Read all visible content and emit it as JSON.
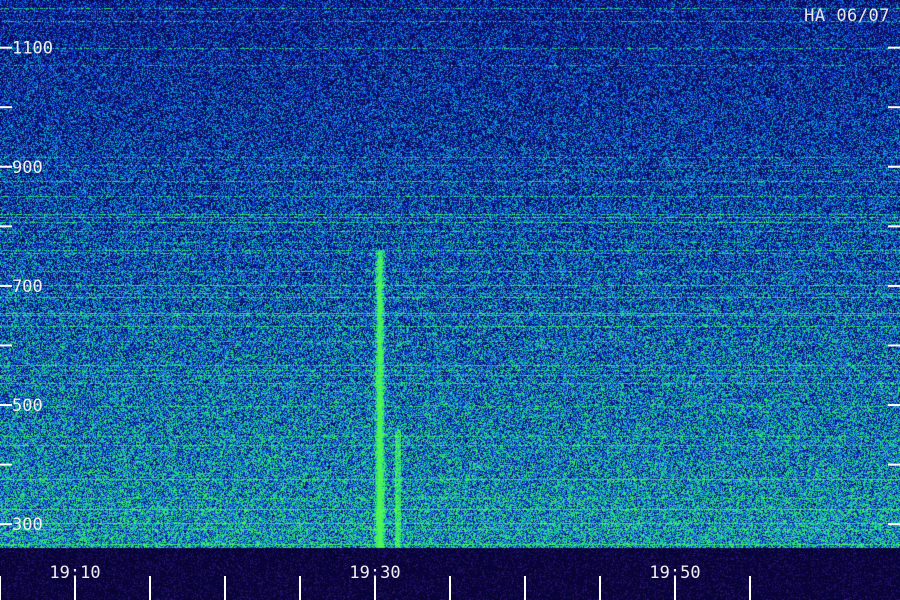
{
  "station_label": "HA 06/07",
  "chart_data": {
    "type": "heatmap",
    "title": "HA 06/07",
    "xlabel": "",
    "ylabel": "",
    "y_ticks": [
      300,
      500,
      700,
      900,
      1100
    ],
    "y_minor_ticks": [
      400,
      600,
      800,
      1000
    ],
    "ylim": [
      260,
      1180
    ],
    "x_tick_labels": [
      "19:10",
      "19:30",
      "19:50"
    ],
    "x_tick_minutes": [
      10,
      30,
      50
    ],
    "x_minor_tick_minutes": [
      5,
      15,
      20,
      25,
      35,
      40,
      45,
      55
    ],
    "xlim_minutes": [
      5,
      65
    ],
    "features": [
      {
        "kind": "burst",
        "time_minutes": 30.3,
        "freq_low": 290,
        "freq_high": 760
      }
    ],
    "colors": {
      "background": "#0b0f6e",
      "mid": "#1a3fd0",
      "high": "#19c9c2",
      "peak": "#3cff6a"
    }
  }
}
